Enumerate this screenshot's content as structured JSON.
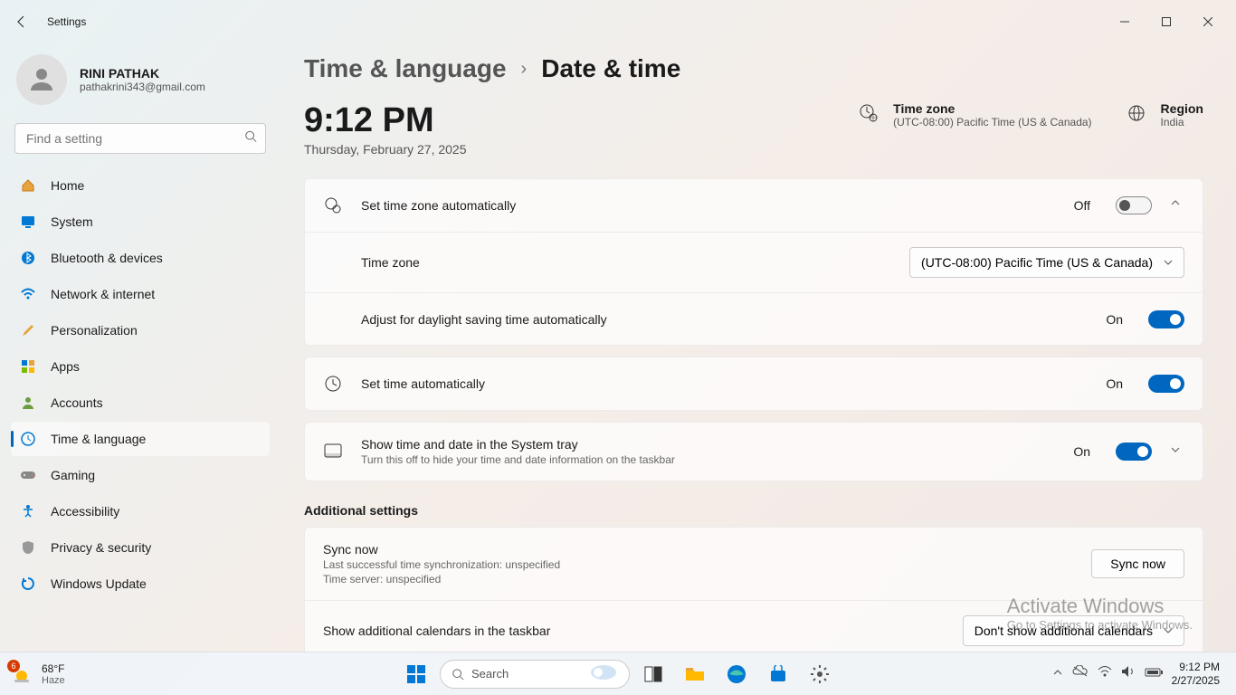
{
  "window": {
    "title": "Settings"
  },
  "profile": {
    "name": "RINI PATHAK",
    "email": "pathakrini343@gmail.com"
  },
  "search": {
    "placeholder": "Find a setting"
  },
  "nav": {
    "home": "Home",
    "system": "System",
    "bluetooth": "Bluetooth & devices",
    "network": "Network & internet",
    "personalization": "Personalization",
    "apps": "Apps",
    "accounts": "Accounts",
    "time": "Time & language",
    "gaming": "Gaming",
    "accessibility": "Accessibility",
    "privacy": "Privacy & security",
    "update": "Windows Update"
  },
  "breadcrumb": {
    "parent": "Time & language",
    "sep": "›",
    "current": "Date & time"
  },
  "clock": {
    "time": "9:12 PM",
    "date": "Thursday, February 27, 2025"
  },
  "info": {
    "tz_label": "Time zone",
    "tz_value": "(UTC-08:00) Pacific Time (US & Canada)",
    "region_label": "Region",
    "region_value": "India"
  },
  "rows": {
    "auto_tz": {
      "title": "Set time zone automatically",
      "state": "Off"
    },
    "tz": {
      "title": "Time zone",
      "value": "(UTC-08:00) Pacific Time (US & Canada)"
    },
    "dst": {
      "title": "Adjust for daylight saving time automatically",
      "state": "On"
    },
    "auto_time": {
      "title": "Set time automatically",
      "state": "On"
    },
    "tray": {
      "title": "Show time and date in the System tray",
      "sub": "Turn this off to hide your time and date information on the taskbar",
      "state": "On"
    }
  },
  "additional": {
    "header": "Additional settings",
    "sync": {
      "title": "Sync now",
      "line1": "Last successful time synchronization: unspecified",
      "line2": "Time server: unspecified",
      "button": "Sync now"
    },
    "calendars": {
      "title": "Show additional calendars in the taskbar",
      "value": "Don't show additional calendars"
    }
  },
  "watermark": {
    "l1": "Activate Windows",
    "l2": "Go to Settings to activate Windows."
  },
  "taskbar": {
    "weather": {
      "temp": "68°F",
      "cond": "Haze",
      "badge": "6"
    },
    "search": "Search",
    "clock": {
      "time": "9:12 PM",
      "date": "2/27/2025"
    }
  }
}
